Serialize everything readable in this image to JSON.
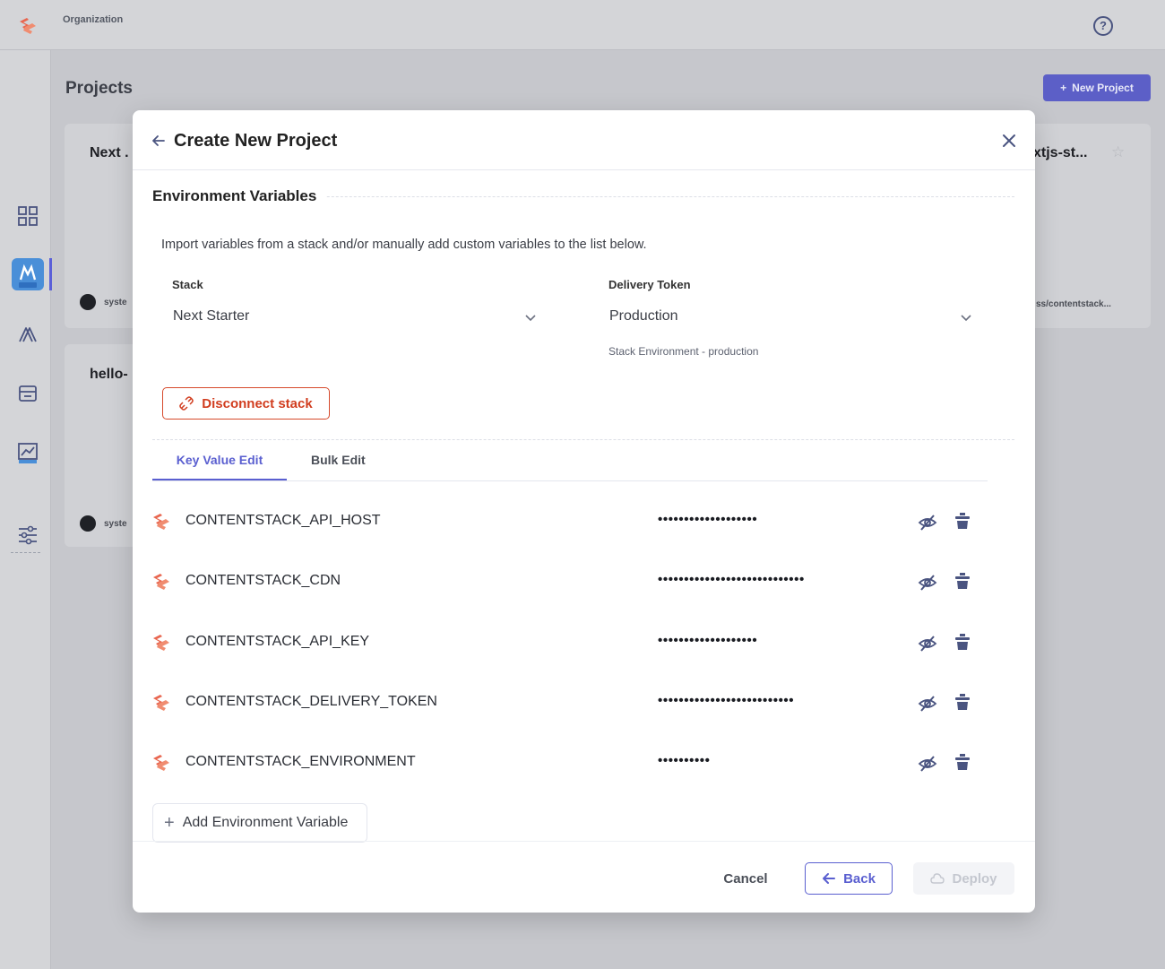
{
  "app": {
    "org_label": "Organization",
    "projects_title": "Projects",
    "new_project_label": "New Project",
    "cards": [
      {
        "title": "Next .",
        "repo": "syste"
      },
      {
        "title": "hello-",
        "repo": "syste"
      },
      {
        "title": "xtjs-st...",
        "repo": "ss/contentstack..."
      }
    ]
  },
  "modal": {
    "title": "Create New Project",
    "section_title": "Environment Variables",
    "intro": "Import variables from a stack and/or manually add custom variables to the list below.",
    "stack": {
      "label": "Stack",
      "value": "Next Starter"
    },
    "delivery_token": {
      "label": "Delivery Token",
      "value": "Production",
      "hint": "Stack Environment - production"
    },
    "disconnect_label": "Disconnect stack",
    "tabs": [
      {
        "label": "Key Value Edit",
        "active": true
      },
      {
        "label": "Bulk Edit",
        "active": false
      }
    ],
    "variables": [
      {
        "key": "CONTENTSTACK_API_HOST",
        "value": "•••••••••••••••••••"
      },
      {
        "key": "CONTENTSTACK_CDN",
        "value": "••••••••••••••••••••••••••••"
      },
      {
        "key": "CONTENTSTACK_API_KEY",
        "value": "•••••••••••••••••••"
      },
      {
        "key": "CONTENTSTACK_DELIVERY_TOKEN",
        "value": "••••••••••••••••••••••••••"
      },
      {
        "key": "CONTENTSTACK_ENVIRONMENT",
        "value": "••••••••••"
      }
    ],
    "add_variable_label": "Add Environment Variable",
    "footer": {
      "cancel": "Cancel",
      "back": "Back",
      "deploy": "Deploy"
    }
  },
  "colors": {
    "accent": "#5a5fd0",
    "danger": "#d6492b",
    "brand": "#e8664f"
  }
}
